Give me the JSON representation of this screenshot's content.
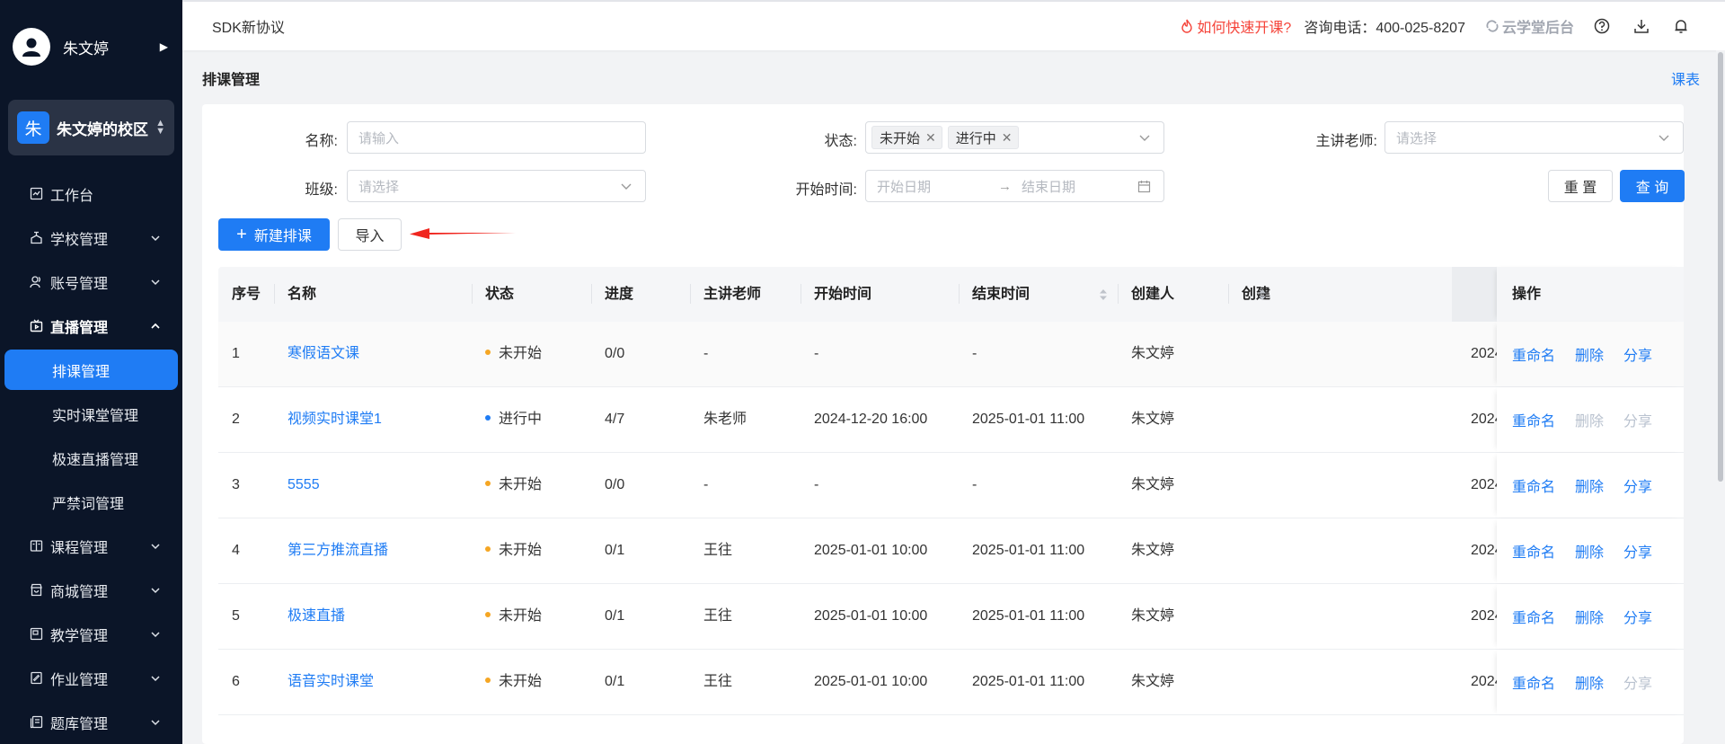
{
  "user": {
    "name": "朱文婷"
  },
  "campus": {
    "badge": "朱",
    "name": "朱文婷的校区"
  },
  "nav": [
    {
      "label": "工作台",
      "icon": "dashboard-icon",
      "has_children": false
    },
    {
      "label": "学校管理",
      "icon": "school-icon",
      "has_children": true
    },
    {
      "label": "账号管理",
      "icon": "account-icon",
      "has_children": true
    },
    {
      "label": "直播管理",
      "icon": "live-icon",
      "has_children": true,
      "open": true,
      "children": [
        {
          "label": "排课管理",
          "active": true
        },
        {
          "label": "实时课堂管理"
        },
        {
          "label": "极速直播管理"
        },
        {
          "label": "严禁词管理"
        }
      ]
    },
    {
      "label": "课程管理",
      "icon": "course-icon",
      "has_children": true
    },
    {
      "label": "商城管理",
      "icon": "shop-icon",
      "has_children": true
    },
    {
      "label": "教学管理",
      "icon": "teaching-icon",
      "has_children": true
    },
    {
      "label": "作业管理",
      "icon": "homework-icon",
      "has_children": true
    },
    {
      "label": "题库管理",
      "icon": "question-bank-icon",
      "has_children": true
    }
  ],
  "header": {
    "title": "SDK新协议",
    "quick_link": "如何快速开课?",
    "phone": "咨询电话：400-025-8207",
    "brand": "云学堂后台"
  },
  "page": {
    "title": "排课管理",
    "schedule_link": "课表"
  },
  "filters": {
    "name_label": "名称:",
    "name_placeholder": "请输入",
    "status_label": "状态:",
    "status_tags": [
      "未开始",
      "进行中"
    ],
    "teacher_label": "主讲老师:",
    "teacher_placeholder": "请选择",
    "class_label": "班级:",
    "class_placeholder": "请选择",
    "time_label": "开始时间:",
    "start_placeholder": "开始日期",
    "end_placeholder": "结束日期",
    "reset": "重 置",
    "search": "查 询"
  },
  "actions": {
    "new": "新建排课",
    "import": "导入"
  },
  "table": {
    "columns": [
      "序号",
      "名称",
      "状态",
      "进度",
      "主讲老师",
      "开始时间",
      "结束时间",
      "创建人",
      "创建",
      "操作"
    ],
    "ops": [
      "重命名",
      "删除",
      "分享"
    ],
    "status_colors": {
      "未开始": "#f5a623",
      "进行中": "#1f7cf4"
    },
    "rows": [
      {
        "no": "1",
        "name": "寒假语文课",
        "status": "未开始",
        "progress": "0/0",
        "teacher": "-",
        "start": "-",
        "end": "-",
        "creator": "朱文婷",
        "created": "2024",
        "delete_disabled": false,
        "share_disabled": false
      },
      {
        "no": "2",
        "name": "视频实时课堂1",
        "status": "进行中",
        "progress": "4/7",
        "teacher": "朱老师",
        "start": "2024-12-20 16:00",
        "end": "2025-01-01 11:00",
        "creator": "朱文婷",
        "created": "2024",
        "delete_disabled": true,
        "share_disabled": true
      },
      {
        "no": "3",
        "name": "5555",
        "status": "未开始",
        "progress": "0/0",
        "teacher": "-",
        "start": "-",
        "end": "-",
        "creator": "朱文婷",
        "created": "2024",
        "delete_disabled": false,
        "share_disabled": false
      },
      {
        "no": "4",
        "name": "第三方推流直播",
        "status": "未开始",
        "progress": "0/1",
        "teacher": "王往",
        "start": "2025-01-01 10:00",
        "end": "2025-01-01 11:00",
        "creator": "朱文婷",
        "created": "2024",
        "delete_disabled": false,
        "share_disabled": false
      },
      {
        "no": "5",
        "name": "极速直播",
        "status": "未开始",
        "progress": "0/1",
        "teacher": "王往",
        "start": "2025-01-01 10:00",
        "end": "2025-01-01 11:00",
        "creator": "朱文婷",
        "created": "2024",
        "delete_disabled": false,
        "share_disabled": false
      },
      {
        "no": "6",
        "name": "语音实时课堂",
        "status": "未开始",
        "progress": "0/1",
        "teacher": "王往",
        "start": "2025-01-01 10:00",
        "end": "2025-01-01 11:00",
        "creator": "朱文婷",
        "created": "2024",
        "delete_disabled": false,
        "share_disabled": true
      }
    ]
  }
}
